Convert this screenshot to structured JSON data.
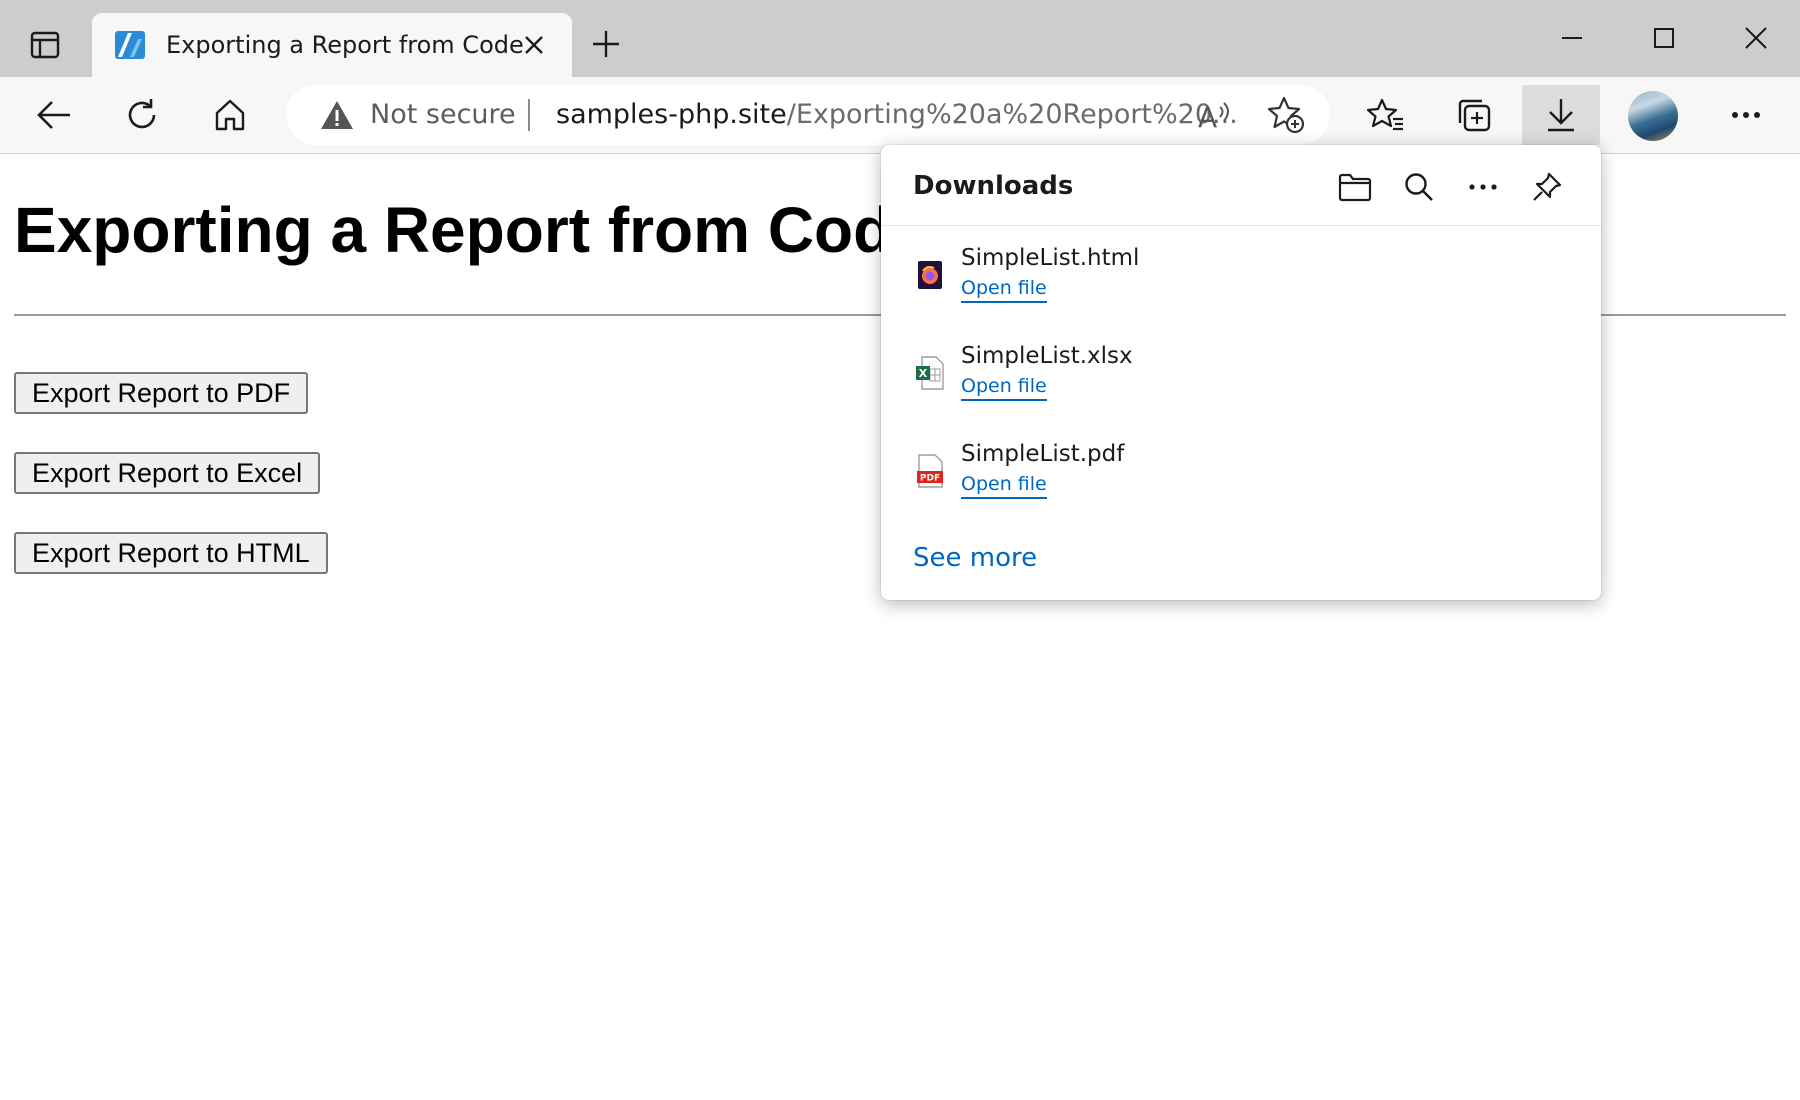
{
  "browser": {
    "tab": {
      "title": "Exporting a Report from Code"
    },
    "address": {
      "security_label": "Not secure",
      "url_host": "samples-php.site",
      "url_path": "/Exporting%20a%20Report%20..."
    },
    "icons": [
      "tab-actions-icon",
      "favicon-icon",
      "close-icon",
      "plus-icon",
      "minimize-icon",
      "maximize-icon",
      "window-close-icon",
      "back-icon",
      "refresh-icon",
      "home-icon",
      "warning-icon",
      "read-aloud-icon",
      "add-favorite-icon",
      "favorites-icon",
      "collections-icon",
      "download-icon",
      "more-icon"
    ]
  },
  "page": {
    "heading": "Exporting a Report from Code",
    "buttons": [
      {
        "label": "Export Report to PDF"
      },
      {
        "label": "Export Report to Excel"
      },
      {
        "label": "Export Report to HTML"
      }
    ]
  },
  "downloads": {
    "title": "Downloads",
    "items": [
      {
        "name": "SimpleList.html",
        "action": "Open file",
        "icon": "firefox-html-file-icon"
      },
      {
        "name": "SimpleList.xlsx",
        "action": "Open file",
        "icon": "excel-file-icon"
      },
      {
        "name": "SimpleList.pdf",
        "action": "Open file",
        "icon": "pdf-file-icon"
      }
    ],
    "see_more": "See more"
  },
  "colors": {
    "tabstrip": "#cdcdcd",
    "toolbar": "#f7f7f7",
    "link": "#0067c0"
  }
}
